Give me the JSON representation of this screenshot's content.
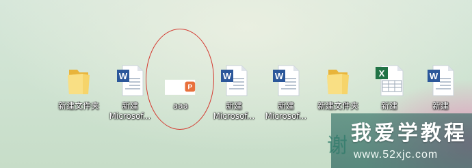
{
  "desktop": {
    "icons": [
      {
        "type": "folder",
        "label_line1": "新建文件夹",
        "label_line2": ""
      },
      {
        "type": "word",
        "label_line1": "新建",
        "label_line2": "Microsof..."
      },
      {
        "type": "pdf-selected",
        "label_line1": "aaa",
        "label_line2": ""
      },
      {
        "type": "word",
        "label_line1": "新建",
        "label_line2": "Microsof..."
      },
      {
        "type": "word",
        "label_line1": "新建",
        "label_line2": "Microsof..."
      },
      {
        "type": "folder",
        "label_line1": "新建文件夹",
        "label_line2": ""
      },
      {
        "type": "excel",
        "label_line1": "新建",
        "label_line2": ""
      },
      {
        "type": "word",
        "label_line1": "新建",
        "label_line2": ""
      }
    ]
  },
  "annotation": {
    "color": "#d43a30"
  },
  "watermark": {
    "title": "我爱学教程",
    "url": "www.52xjc.com",
    "fragment": "谢"
  },
  "colors": {
    "word_blue": "#2b579a",
    "excel_green": "#217346",
    "folder_yellow": "#f3c64d",
    "pdf_orange": "#e8703c"
  }
}
